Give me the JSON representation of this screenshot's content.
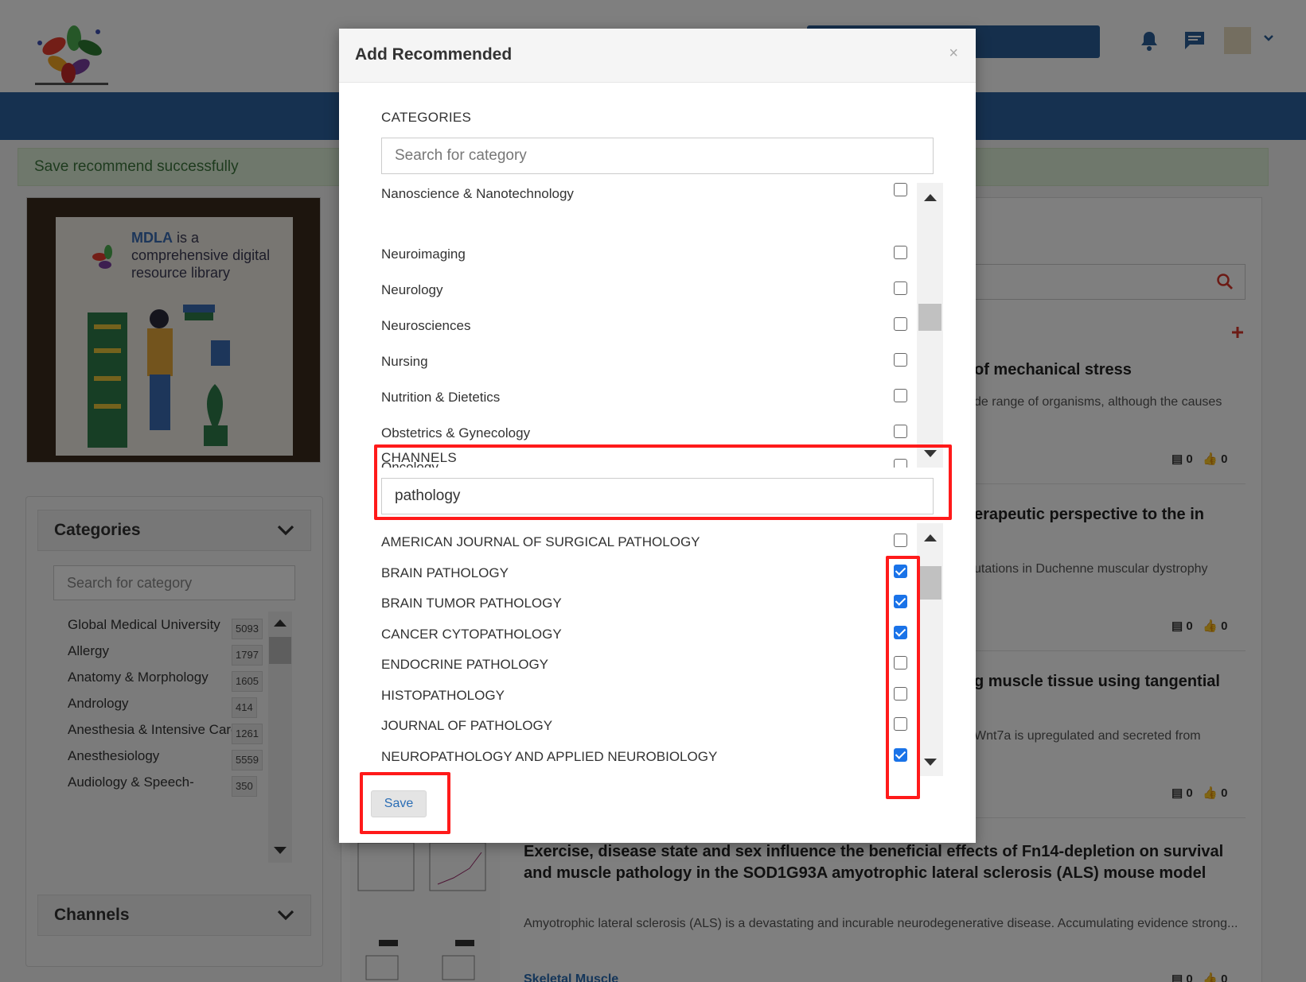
{
  "alert": {
    "message": "Save recommend successfully"
  },
  "banner": {
    "brand": "MDLA",
    "text": " is a comprehensive digital resource library"
  },
  "sidebar": {
    "categories_title": "Categories",
    "search_placeholder": "Search for category",
    "items": [
      {
        "label": "Global Medical University",
        "count": "5093"
      },
      {
        "label": "Allergy",
        "count": "1797"
      },
      {
        "label": "Anatomy & Morphology",
        "count": "1605"
      },
      {
        "label": "Andrology",
        "count": "414"
      },
      {
        "label": "Anesthesia & Intensive Care",
        "count": "1261"
      },
      {
        "label": "Anesthesiology",
        "count": "5559"
      },
      {
        "label": "Audiology & Speech-",
        "count": "350"
      }
    ],
    "channels_title": "Channels"
  },
  "articles": [
    {
      "title": "of mechanical stress",
      "snippet": "de range of organisms, although the causes",
      "comments": "0",
      "likes": "0"
    },
    {
      "title": "erapeutic perspective to the in",
      "snippet": "utations in Duchenne muscular dystrophy",
      "comments": "0",
      "likes": "0"
    },
    {
      "title": "g muscle tissue using tangential",
      "snippet": "Wnt7a is upregulated and secreted from",
      "comments": "0",
      "likes": "0"
    },
    {
      "title": "Exercise, disease state and sex influence the beneficial effects of Fn14-depletion on survival and muscle pathology in the SOD1G93A amyotrophic lateral sclerosis (ALS) mouse model",
      "snippet": "Amyotrophic lateral sclerosis (ALS) is a devastating and incurable neurodegenerative disease. Accumulating evidence strong...",
      "tag": "Skeletal Muscle",
      "comments": "0",
      "likes": "0"
    }
  ],
  "modal": {
    "title": "Add Recommended",
    "close": "×",
    "categories_label": "CATEGORIES",
    "categories_placeholder": "Search for category",
    "categories": [
      {
        "label": "Nanoscience & Nanotechnology",
        "checked": false
      },
      {
        "label": "Neuroimaging",
        "checked": false
      },
      {
        "label": "Neurology",
        "checked": false
      },
      {
        "label": "Neurosciences",
        "checked": false
      },
      {
        "label": "Nursing",
        "checked": false
      },
      {
        "label": "Nutrition & Dietetics",
        "checked": false
      },
      {
        "label": "Obstetrics & Gynecology",
        "checked": false
      },
      {
        "label": "Oncology",
        "checked": false
      }
    ],
    "channels_label": "CHANNELS",
    "channels_search_value": "pathology",
    "channels": [
      {
        "label": "AMERICAN JOURNAL OF SURGICAL PATHOLOGY",
        "checked": false
      },
      {
        "label": "BRAIN PATHOLOGY",
        "checked": true
      },
      {
        "label": "BRAIN TUMOR PATHOLOGY",
        "checked": true
      },
      {
        "label": "CANCER CYTOPATHOLOGY",
        "checked": true
      },
      {
        "label": "ENDOCRINE PATHOLOGY",
        "checked": false
      },
      {
        "label": "HISTOPATHOLOGY",
        "checked": false
      },
      {
        "label": "JOURNAL OF PATHOLOGY",
        "checked": false
      },
      {
        "label": "NEUROPATHOLOGY AND APPLIED NEUROBIOLOGY",
        "checked": true
      }
    ],
    "save_label": "Save"
  },
  "colors": {
    "accent": "#2d62a0",
    "highlight": "#ff1a1a",
    "checkbox_on": "#1a73e8"
  }
}
